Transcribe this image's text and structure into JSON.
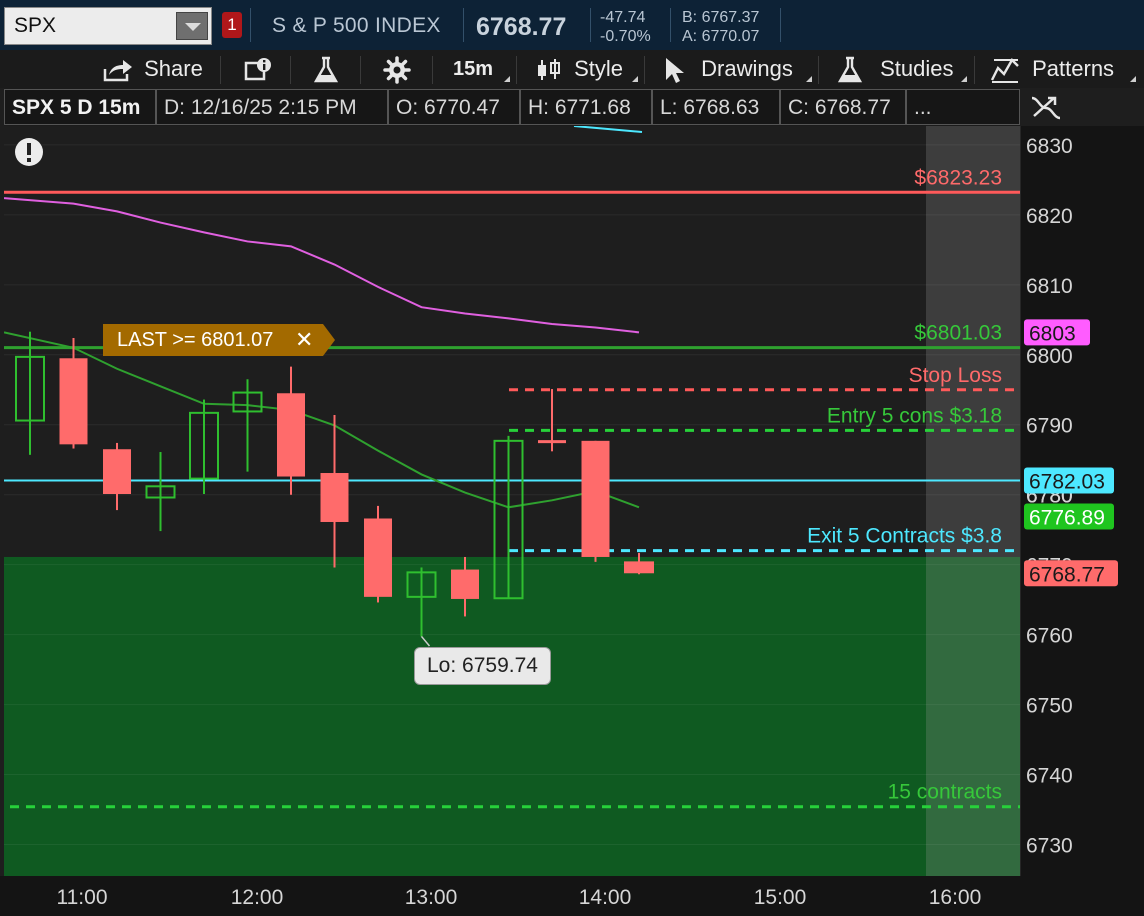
{
  "header": {
    "symbol": "SPX",
    "alert_count": "1",
    "index_name": "S & P 500 INDEX",
    "last": "6768.77",
    "change": "-47.74",
    "change_pct": "-0.70%",
    "bid": "B: 6767.37",
    "ask": "A: 6770.07"
  },
  "toolbar": {
    "share": "Share",
    "timeframe": "15m",
    "style": "Style",
    "drawings": "Drawings",
    "studies": "Studies",
    "patterns": "Patterns"
  },
  "infobar": {
    "title": "SPX 5 D 15m",
    "date": "D: 12/16/25 2:15 PM",
    "open": "O: 6770.47",
    "high": "H: 6771.68",
    "low": "L: 6768.63",
    "close": "C: 6768.77",
    "more": "..."
  },
  "colors": {
    "up": "#2fbf2f",
    "down": "#ff6b6b",
    "cyan": "#4de8ff",
    "magenta": "#e060e0",
    "green_line": "#2fa12f",
    "red_line": "#ff5a5a",
    "loss_zone": "#0f5a21"
  },
  "chart_data": {
    "type": "candlestick",
    "y_axis": {
      "ticks": [
        "6830",
        "6820",
        "6810",
        "6800",
        "6790",
        "6780",
        "6770",
        "6760",
        "6750",
        "6740",
        "6730"
      ],
      "range": [
        6725.5,
        6832.7
      ]
    },
    "x_axis": {
      "ticks": [
        "11:00",
        "12:00",
        "13:00",
        "14:00",
        "15:00",
        "16:00"
      ]
    },
    "candles": [
      {
        "o": 6790.6,
        "h": 6803.3,
        "l": 6785.7,
        "c": 6799.7
      },
      {
        "o": 6799.5,
        "h": 6802.4,
        "l": 6786.6,
        "c": 6787.2
      },
      {
        "o": 6786.5,
        "h": 6787.4,
        "l": 6777.8,
        "c": 6780.1
      },
      {
        "o": 6779.6,
        "h": 6786.1,
        "l": 6774.8,
        "c": 6781.2
      },
      {
        "o": 6782.3,
        "h": 6793.6,
        "l": 6780.1,
        "c": 6791.7
      },
      {
        "o": 6791.9,
        "h": 6796.5,
        "l": 6783.3,
        "c": 6794.6
      },
      {
        "o": 6794.5,
        "h": 6798.3,
        "l": 6780.0,
        "c": 6782.6
      },
      {
        "o": 6783.1,
        "h": 6791.4,
        "l": 6769.6,
        "c": 6776.1
      },
      {
        "o": 6776.6,
        "h": 6778.4,
        "l": 6764.6,
        "c": 6765.4
      },
      {
        "o": 6765.4,
        "h": 6769.6,
        "l": 6759.74,
        "c": 6768.9
      },
      {
        "o": 6769.3,
        "h": 6771.1,
        "l": 6762.6,
        "c": 6765.1
      },
      {
        "o": 6765.2,
        "h": 6788.4,
        "l": 6765.2,
        "c": 6787.7
      },
      {
        "o": 6787.8,
        "h": 6795.1,
        "l": 6786.2,
        "c": 6787.4
      },
      {
        "o": 6787.7,
        "h": 6787.7,
        "l": 6770.4,
        "c": 6771.1
      },
      {
        "o": 6770.47,
        "h": 6771.68,
        "l": 6768.63,
        "c": 6768.77
      }
    ],
    "series": [
      {
        "name": "sma_green",
        "values": [
          6803.2,
          6801.0,
          6798.0,
          6795.5,
          6793.0,
          6792.8,
          6792.1,
          6789.9,
          6786.3,
          6782.9,
          6780.3,
          6778.2,
          6779.2,
          6780.5,
          6778.2
        ]
      },
      {
        "name": "sma_magenta",
        "values": [
          6822.4,
          6821.6,
          6820.5,
          6818.9,
          6817.5,
          6816.2,
          6815.5,
          6812.9,
          6809.7,
          6806.8,
          6805.9,
          6805.2,
          6804.4,
          6803.9,
          6803.2
        ]
      }
    ],
    "levels": {
      "resistance": {
        "value": 6823.23,
        "label": "$6823.23"
      },
      "alert_line": {
        "value": 6801.03,
        "label": "$6801.03"
      },
      "stop_loss": {
        "value": 6795.0,
        "label": "Stop Loss"
      },
      "entry": {
        "value": 6789.2,
        "label": "Entry 5  cons $3.18"
      },
      "cyan": {
        "value": 6782.03
      },
      "exit": {
        "value": 6772.0,
        "label": "Exit 5 Contracts $3.8"
      },
      "contracts15": {
        "value": 6735.4,
        "label": "15 contracts"
      },
      "zone_top": 6771.1
    },
    "alert_label": "LAST >= 6801.07",
    "low_callout": "Lo: 6759.74",
    "price_tags": {
      "magenta": "6803",
      "cyan": "6782.03",
      "green": "6776.89",
      "last": "6768.77",
      "hidden": "6780"
    }
  }
}
